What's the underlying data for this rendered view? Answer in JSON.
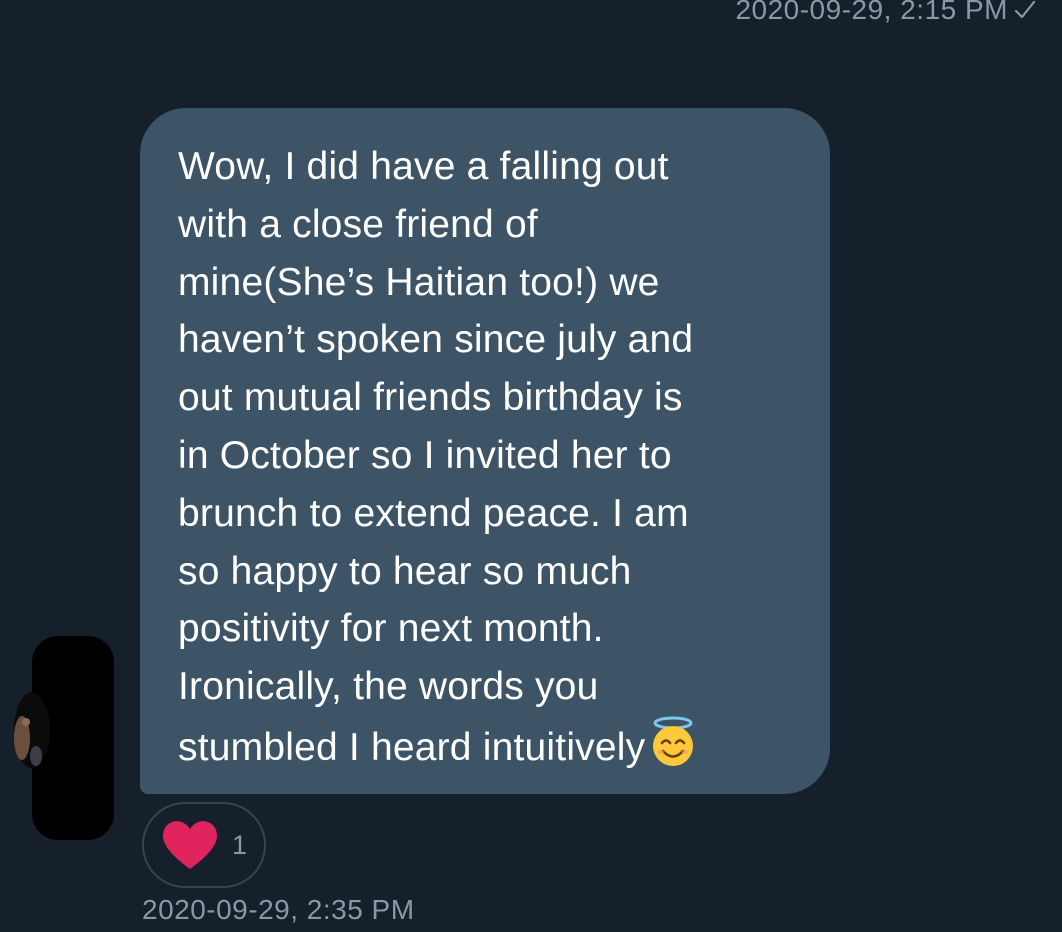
{
  "previous_message": {
    "timestamp": "2020-09-29, 2:15 PM",
    "status_icon": "check-icon"
  },
  "message": {
    "lines": [
      "Wow, I did have a falling out",
      "with a close friend of",
      "mine(She’s Haitian too!) we",
      "haven’t spoken since july and",
      "out mutual friends birthday is",
      "in October so I invited her to",
      "brunch to extend peace. I am",
      "so happy to hear so much",
      "positivity for next month.",
      "Ironically, the words you",
      "stumbled I heard intuitively"
    ],
    "trailing_emoji": "smiling-face-with-halo-icon",
    "timestamp": "2020-09-29, 2:35 PM"
  },
  "reaction": {
    "icon": "heart-icon",
    "count": "1"
  },
  "colors": {
    "background": "#15202b",
    "bubble": "#3d5466",
    "muted_text": "#8899a6",
    "heart": "#e0245e"
  }
}
